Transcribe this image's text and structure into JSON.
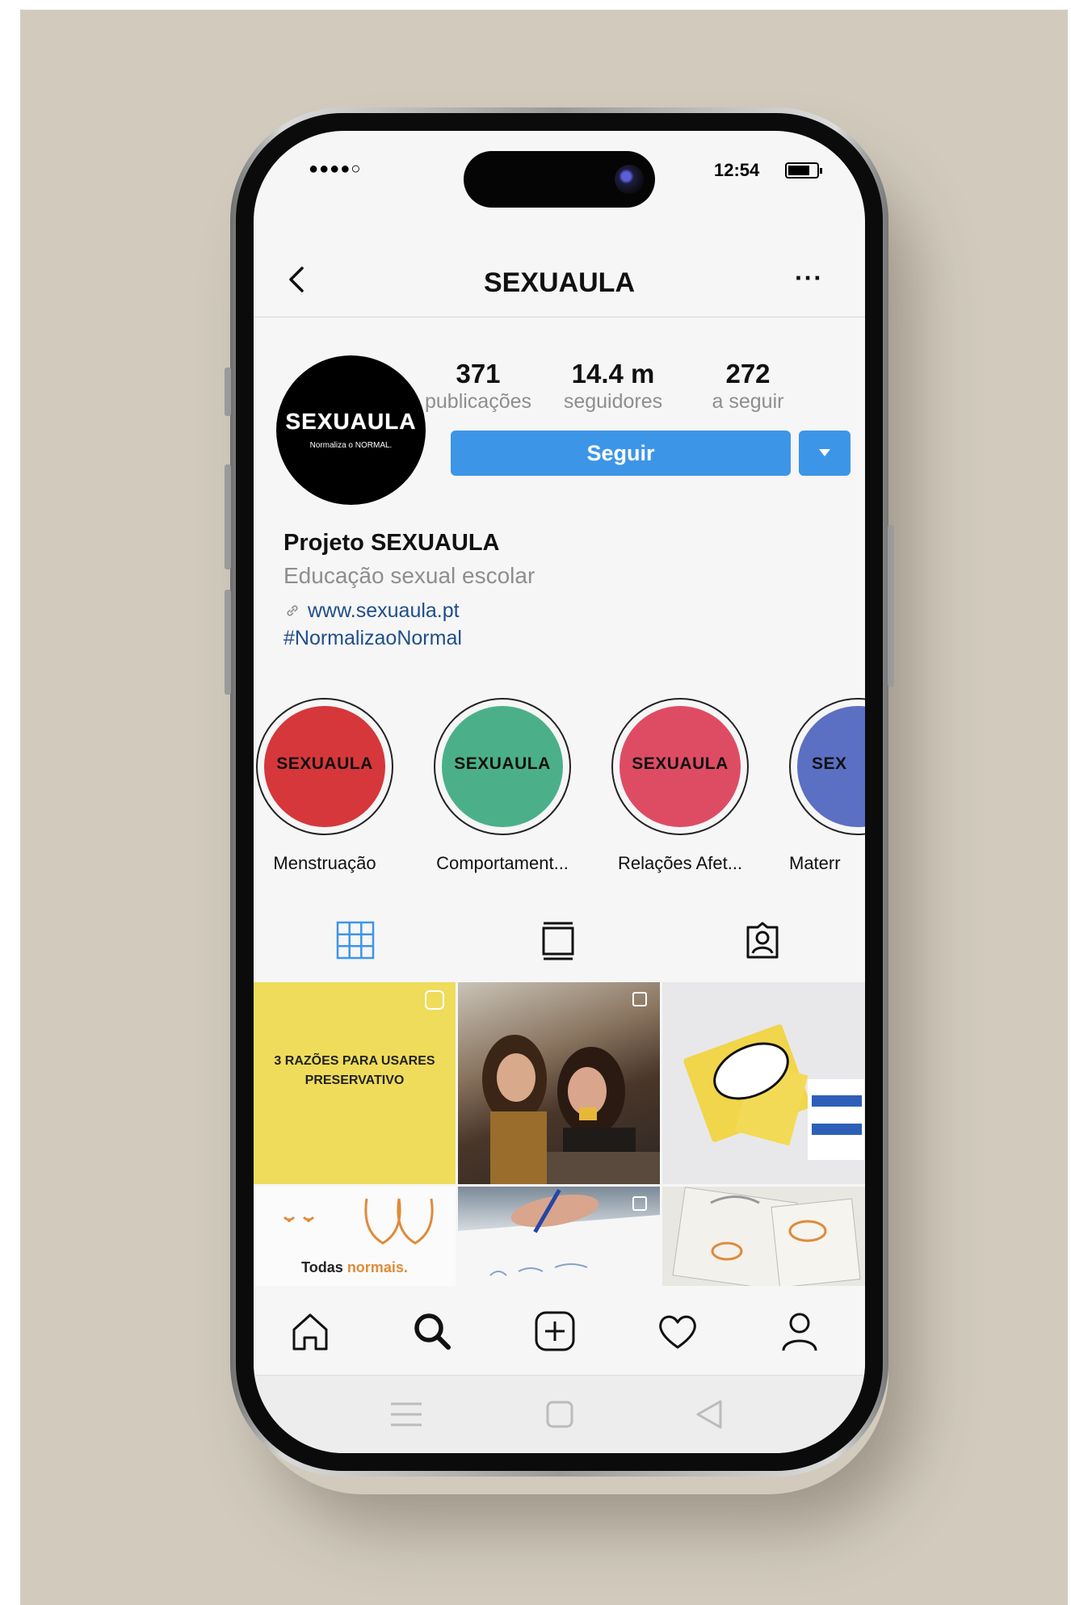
{
  "status_bar": {
    "signal": "●●●●○",
    "time": "12:54"
  },
  "header": {
    "title": "SEXUAULA",
    "back_icon": "chevron-left-icon",
    "more_label": "···"
  },
  "profile": {
    "avatar_text": "SEXUAULA",
    "avatar_subtext": "Normaliza o NORMAL.",
    "stats": [
      {
        "value": "371",
        "label": "publicações"
      },
      {
        "value": "14.4 m",
        "label": "seguidores"
      },
      {
        "value": "272",
        "label": "a seguir"
      }
    ],
    "follow_label": "Seguir",
    "accent_color": "#3d95e8"
  },
  "bio": {
    "name": "Projeto SEXUAULA",
    "description": "Educação sexual escolar",
    "link": "www.sexuaula.pt",
    "hashtag": "#NormalizaoNormal"
  },
  "highlights": [
    {
      "label": "Menstruação",
      "ring_text": "SEXUAULA",
      "color": "#d6373b"
    },
    {
      "label": "Comportament...",
      "ring_text": "SEXUAULA",
      "color": "#4bb08a"
    },
    {
      "label": "Relações Afet...",
      "ring_text": "SEXUAULA",
      "color": "#de4c64"
    },
    {
      "label": "Materr",
      "ring_text": "SEX",
      "color": "#5b6fc3"
    }
  ],
  "tabs": [
    {
      "name": "grid-icon",
      "active": true
    },
    {
      "name": "feed-icon",
      "active": false
    },
    {
      "name": "tagged-icon",
      "active": false
    }
  ],
  "posts": {
    "post1_text": "3 RAZÕES PARA USARES PRESERVATIVO",
    "post4_text_a": "Todas ",
    "post4_text_b": "normais."
  },
  "bottom_nav": [
    "home-icon",
    "search-icon",
    "add-post-icon",
    "heart-icon",
    "profile-icon"
  ]
}
